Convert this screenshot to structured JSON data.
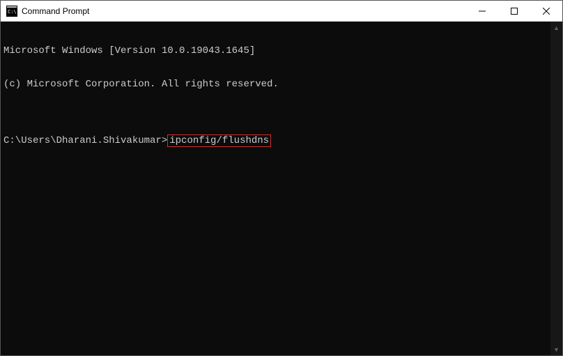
{
  "window": {
    "title": "Command Prompt"
  },
  "terminal": {
    "line1": "Microsoft Windows [Version 10.0.19043.1645]",
    "line2": "(c) Microsoft Corporation. All rights reserved.",
    "blank": "",
    "prompt": "C:\\Users\\Dharani.Shivakumar>",
    "command": "ipconfig/flushdns"
  },
  "icons": {
    "cmd": "cmd-icon",
    "minimize": "—",
    "maximize": "□",
    "close": "✕",
    "scrollUp": "▲",
    "scrollDown": "▼"
  }
}
